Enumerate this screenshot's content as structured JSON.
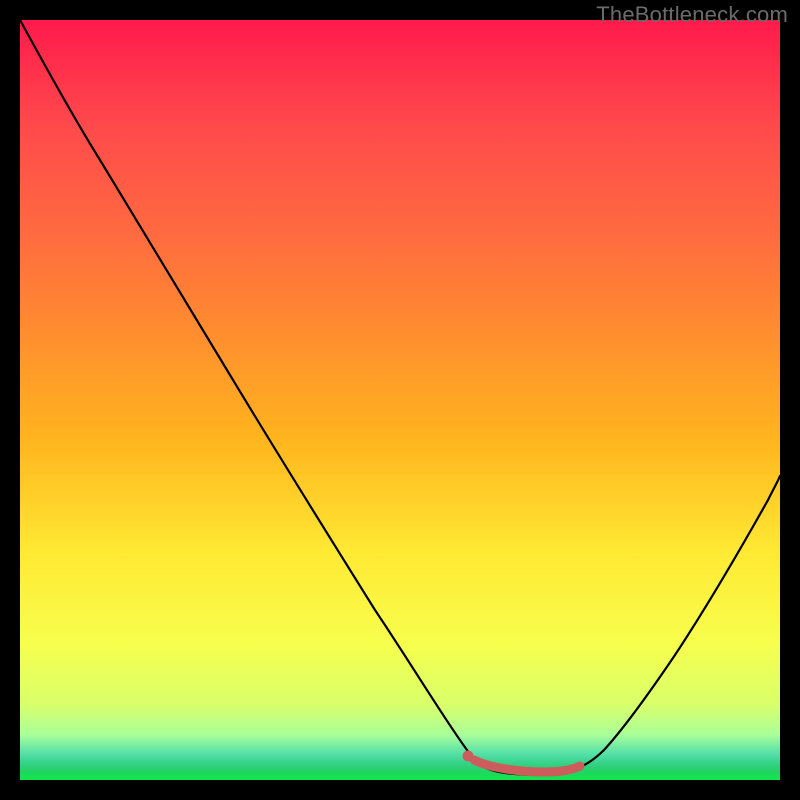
{
  "watermark": "TheBottleneck.com",
  "chart_data": {
    "type": "line",
    "title": "",
    "xlabel": "",
    "ylabel": "",
    "xlim": [
      0,
      100
    ],
    "ylim": [
      0,
      100
    ],
    "series": [
      {
        "name": "bottleneck-curve",
        "x": [
          0,
          6,
          12,
          18,
          24,
          30,
          36,
          42,
          48,
          55,
          59,
          62,
          66,
          70,
          74,
          78,
          82,
          88,
          94,
          100
        ],
        "y": [
          100,
          92,
          83,
          74,
          64,
          54,
          44,
          34,
          24,
          10,
          3,
          1,
          0.5,
          0.5,
          1,
          4,
          10,
          22,
          36,
          50
        ]
      }
    ],
    "annotations": [
      {
        "name": "min-marker",
        "type": "segment",
        "x": [
          59,
          73.5
        ],
        "y": [
          2.2,
          1.4
        ],
        "color": "#cd5c5c"
      },
      {
        "name": "min-dot",
        "type": "point",
        "x": 59,
        "y": 2.6,
        "color": "#cd5c5c"
      }
    ],
    "background": {
      "type": "vertical-gradient",
      "stops": [
        {
          "pos": 0,
          "color": "#ff1a4b"
        },
        {
          "pos": 0.4,
          "color": "#ff8a30"
        },
        {
          "pos": 0.7,
          "color": "#ffe933"
        },
        {
          "pos": 0.95,
          "color": "#aaff99"
        },
        {
          "pos": 1.0,
          "color": "#0fe84b"
        }
      ]
    }
  }
}
